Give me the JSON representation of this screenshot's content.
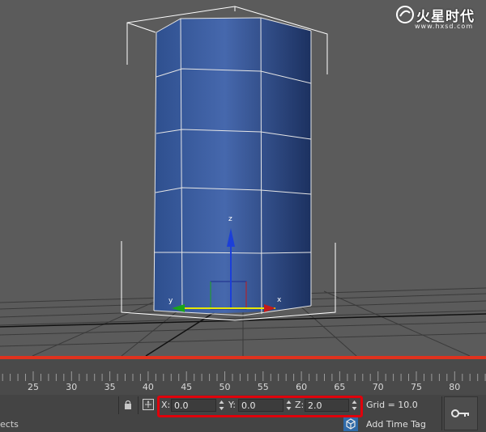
{
  "watermark": {
    "brand": "火星时代",
    "url": "www.hxsd.com"
  },
  "viewport": {
    "axis_x": "x",
    "axis_y": "y",
    "axis_z": "z"
  },
  "timeline": {
    "ticks": [
      "25",
      "30",
      "35",
      "40",
      "45",
      "50",
      "55",
      "60",
      "65",
      "70",
      "75",
      "80"
    ]
  },
  "coords": {
    "x_label": "X:",
    "x_value": "0.0",
    "y_label": "Y:",
    "y_value": "0.0",
    "z_label": "Z:",
    "z_value": "2.0"
  },
  "grid": {
    "text": "Grid = 10.0"
  },
  "status": {
    "prompt_text": "ects",
    "add_time_tag": "Add Time Tag"
  },
  "icons": {
    "lock": "lock-icon",
    "transform_mode": "transform-mode-icon",
    "key": "key-icon",
    "time_tag": "time-tag-icon"
  },
  "colors": {
    "cylinder": "#3f63a6",
    "timeline_bar": "#e0321e",
    "highlight": "#e0000b"
  }
}
